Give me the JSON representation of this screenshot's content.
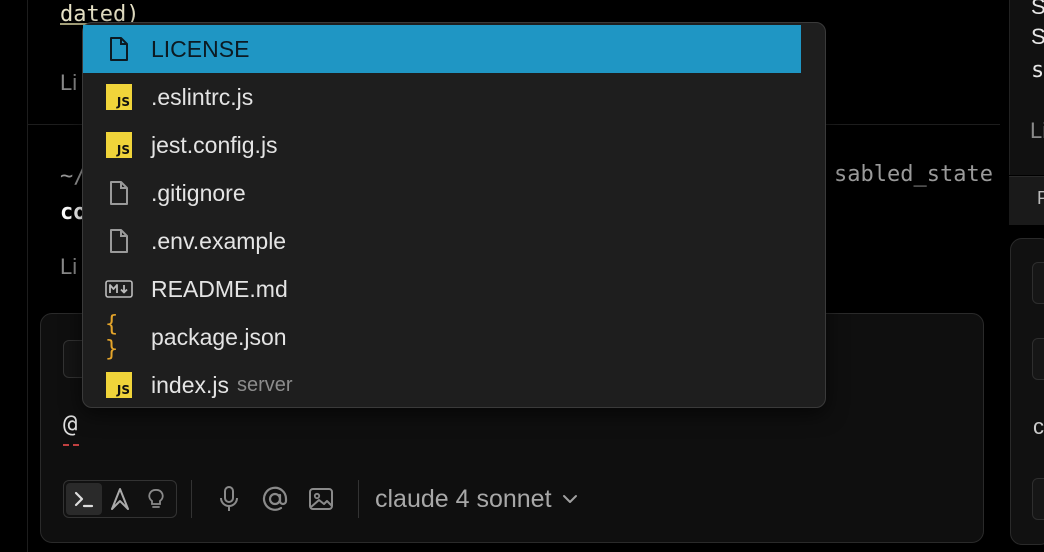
{
  "background": {
    "dated_text": "dated)",
    "li_label": "Li",
    "path_text": "~/",
    "state_text": "sabled_state",
    "bold_text": "co"
  },
  "dropdown": {
    "items": [
      {
        "label": "LICENSE",
        "icon": "file-icon",
        "selected": true
      },
      {
        "label": ".eslintrc.js",
        "icon": "js-icon"
      },
      {
        "label": "jest.config.js",
        "icon": "js-icon"
      },
      {
        "label": ".gitignore",
        "icon": "file-icon"
      },
      {
        "label": ".env.example",
        "icon": "file-icon"
      },
      {
        "label": "README.md",
        "icon": "markdown-icon"
      },
      {
        "label": "package.json",
        "icon": "json-icon"
      },
      {
        "label": "index.js",
        "icon": "js-icon",
        "sublabel": "server"
      }
    ],
    "js_badge_text": "JS",
    "json_badge_text": "{ }",
    "md_badge_text": "M↓"
  },
  "composer": {
    "input_value": "@",
    "model_label": "claude 4 sonnet",
    "toolbar_icons": [
      "terminal-icon",
      "agent-icon",
      "lightbulb-icon",
      "microphone-icon",
      "at-sign-icon",
      "image-icon"
    ]
  },
  "right_panel": {
    "line1": "S",
    "line2": "S",
    "line3": "s",
    "li_label": "Li",
    "tab_label": "P",
    "c_label": "c"
  },
  "colors": {
    "selected": "#1f96c4",
    "js_badge": "#f0d43a",
    "json_brace": "#e5a52a"
  }
}
